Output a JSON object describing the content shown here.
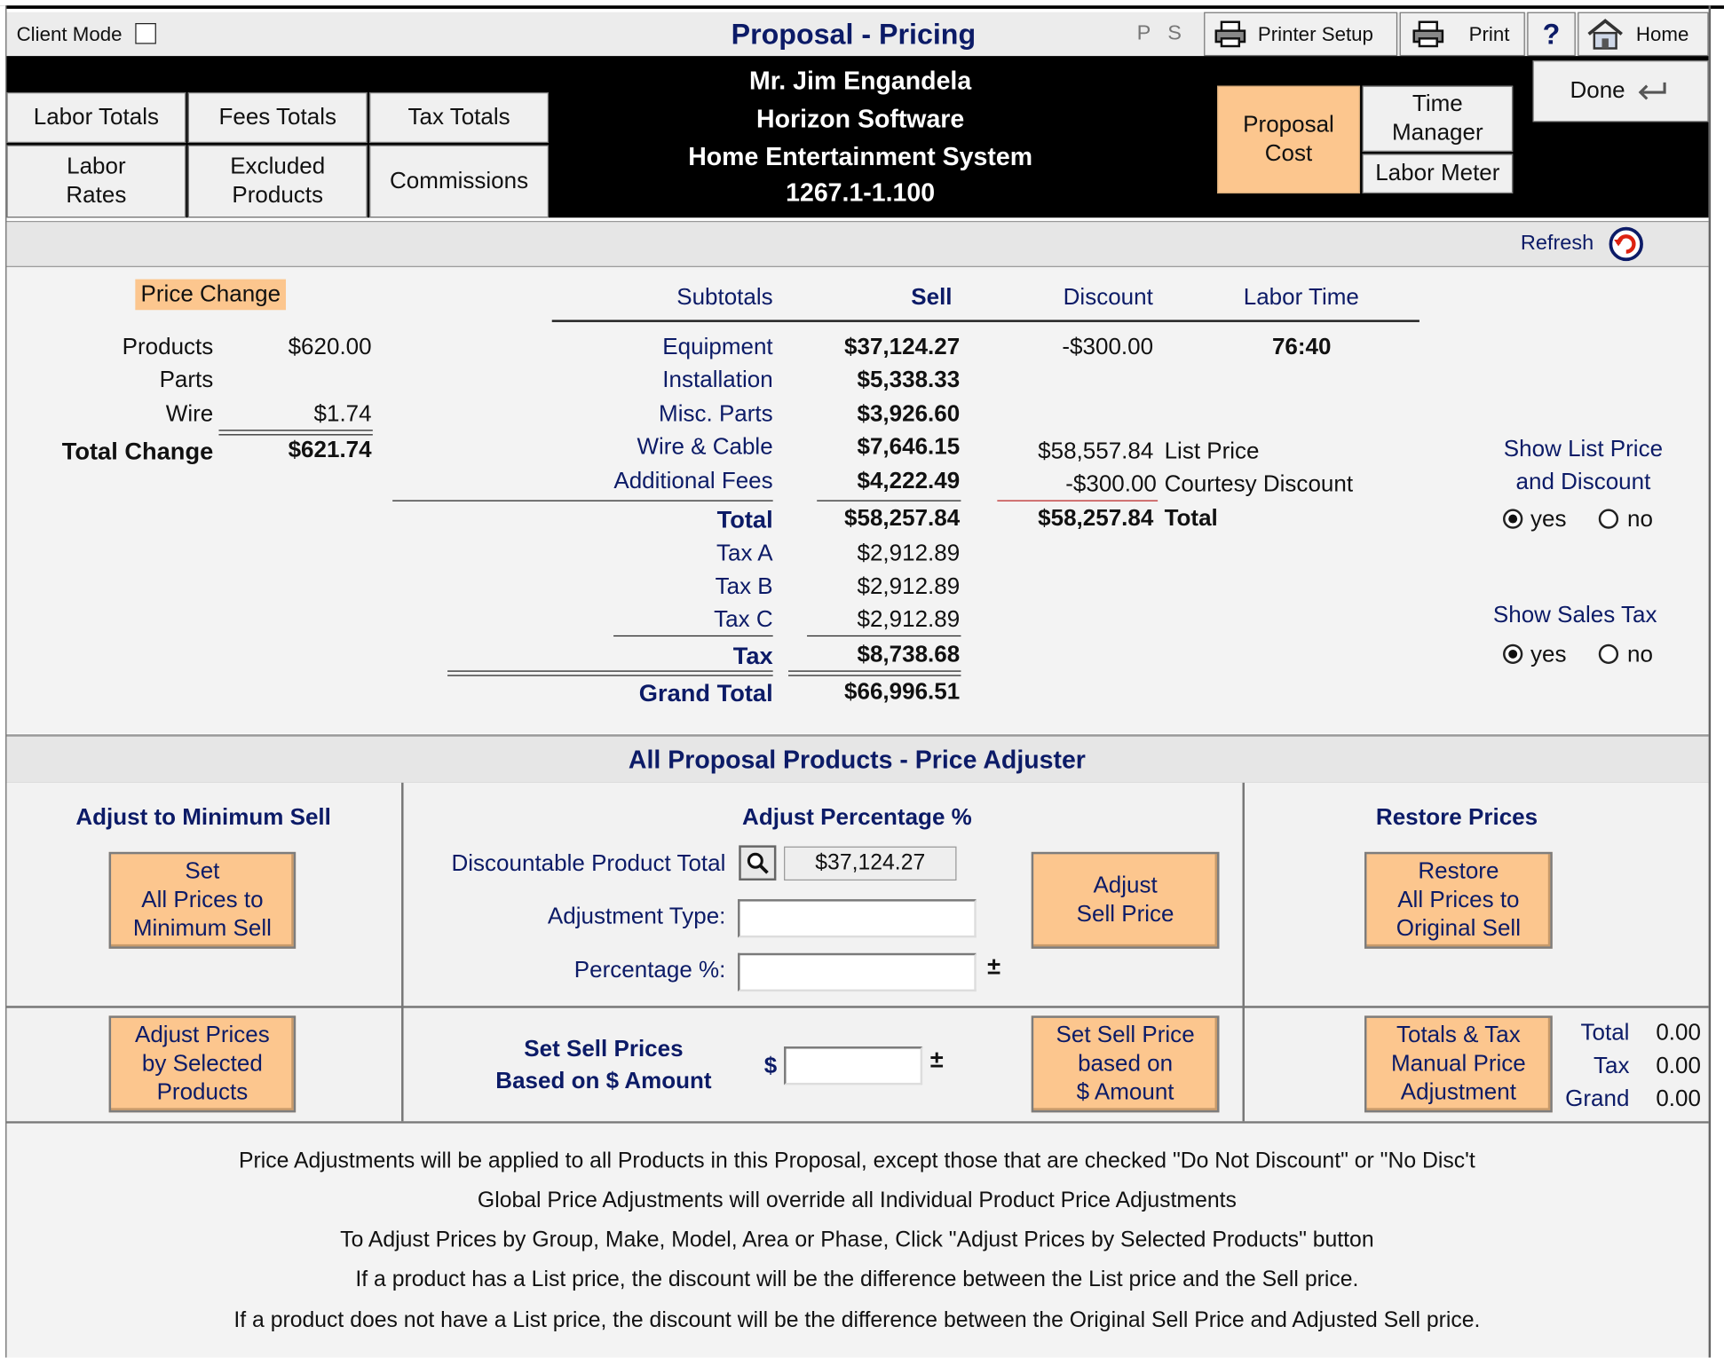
{
  "header": {
    "client_mode_label": "Client Mode",
    "title": "Proposal - Pricing",
    "p_label": "P",
    "s_label": "S",
    "printer_setup": "Printer Setup",
    "print": "Print",
    "help": "?",
    "home": "Home",
    "done": "Done"
  },
  "tabs": {
    "labor_totals": "Labor Totals",
    "fees_totals": "Fees Totals",
    "tax_totals": "Tax Totals",
    "labor_rates_1": "Labor",
    "labor_rates_2": "Rates",
    "excluded_products_1": "Excluded",
    "excluded_products_2": "Products",
    "commissions": "Commissions",
    "proposal_cost_1": "Proposal",
    "proposal_cost_2": "Cost",
    "time_manager_1": "Time",
    "time_manager_2": "Manager",
    "labor_meter": "Labor Meter"
  },
  "client": {
    "name": "Mr. Jim Engandela",
    "company": "Horizon Software",
    "project": "Home Entertainment System",
    "number": "1267.1-1.100"
  },
  "refresh": "Refresh",
  "price_change": {
    "label": "Price Change",
    "products_label": "Products",
    "products_value": "$620.00",
    "parts_label": "Parts",
    "wire_label": "Wire",
    "wire_value": "$1.74",
    "total_label": "Total Change",
    "total_value": "$621.74"
  },
  "subtotals": {
    "headers": {
      "subtotals": "Subtotals",
      "sell": "Sell",
      "discount": "Discount",
      "labor_time": "Labor Time"
    },
    "rows": [
      {
        "label": "Equipment",
        "sell": "$37,124.27",
        "discount": "-$300.00",
        "labor": "76:40"
      },
      {
        "label": "Installation",
        "sell": "$5,338.33"
      },
      {
        "label": "Misc. Parts",
        "sell": "$3,926.60"
      },
      {
        "label": "Wire & Cable",
        "sell": "$7,646.15"
      },
      {
        "label": "Additional Fees",
        "sell": "$4,222.49"
      }
    ],
    "total_label": "Total",
    "total_value": "$58,257.84",
    "tax_rows": [
      {
        "label": "Tax A",
        "value": "$2,912.89"
      },
      {
        "label": "Tax B",
        "value": "$2,912.89"
      },
      {
        "label": "Tax C",
        "value": "$2,912.89"
      }
    ],
    "tax_label": "Tax",
    "tax_value": "$8,738.68",
    "grand_label": "Grand Total",
    "grand_value": "$66,996.51",
    "list_price_value": "$58,557.84",
    "list_price_label": "List Price",
    "courtesy_value": "-$300.00",
    "courtesy_label": "Courtesy Discount",
    "disc_total_value": "$58,257.84",
    "disc_total_label": "Total"
  },
  "options": {
    "show_list_1": "Show List Price",
    "show_list_2": "and Discount",
    "show_tax": "Show Sales Tax",
    "yes": "yes",
    "no": "no"
  },
  "adjuster": {
    "title": "All Proposal Products - Price Adjuster",
    "min_title": "Adjust to Minimum Sell",
    "min_btn": [
      "Set",
      "All Prices to",
      "Minimum Sell"
    ],
    "pct_title": "Adjust Percentage %",
    "discountable_label": "Discountable Product Total",
    "discountable_value": "$37,124.27",
    "adj_type_label": "Adjustment Type:",
    "percentage_label": "Percentage %:",
    "adjust_btn": [
      "Adjust",
      "Sell Price"
    ],
    "restore_title": "Restore Prices",
    "restore_btn": [
      "Restore",
      "All Prices to",
      "Original Sell"
    ],
    "selected_btn": [
      "Adjust Prices",
      "by Selected",
      "Products"
    ],
    "set_amount_title_1": "Set Sell Prices",
    "set_amount_title_2": "Based on $ Amount",
    "dollar": "$",
    "plusminus": "±",
    "set_amount_btn": [
      "Set Sell Price",
      "based on",
      "$ Amount"
    ],
    "manual_btn": [
      "Totals & Tax",
      "Manual Price",
      "Adjustment"
    ],
    "manual_total_label": "Total",
    "manual_total_value": "0.00",
    "manual_tax_label": "Tax",
    "manual_tax_value": "0.00",
    "manual_grand_label": "Grand",
    "manual_grand_value": "0.00"
  },
  "notes": [
    "Price Adjustments will be applied to all Products in this Proposal, except those that are checked \"Do Not Discount\" or \"No Disc't",
    "Global Price Adjustments will override all Individual Product Price Adjustments",
    "To Adjust Prices by Group, Make, Model, Area or Phase, Click \"Adjust Prices by Selected Products\" button",
    "If a product has a List price, the discount will be the difference between the List price and the Sell price.",
    "If a product does not have a List price, the discount will be the difference between the Original Sell Price and Adjusted Sell price."
  ],
  "colors": {
    "accent_orange": "#fcc68e",
    "title_navy": "#0c1b67",
    "header_black": "#000000"
  }
}
